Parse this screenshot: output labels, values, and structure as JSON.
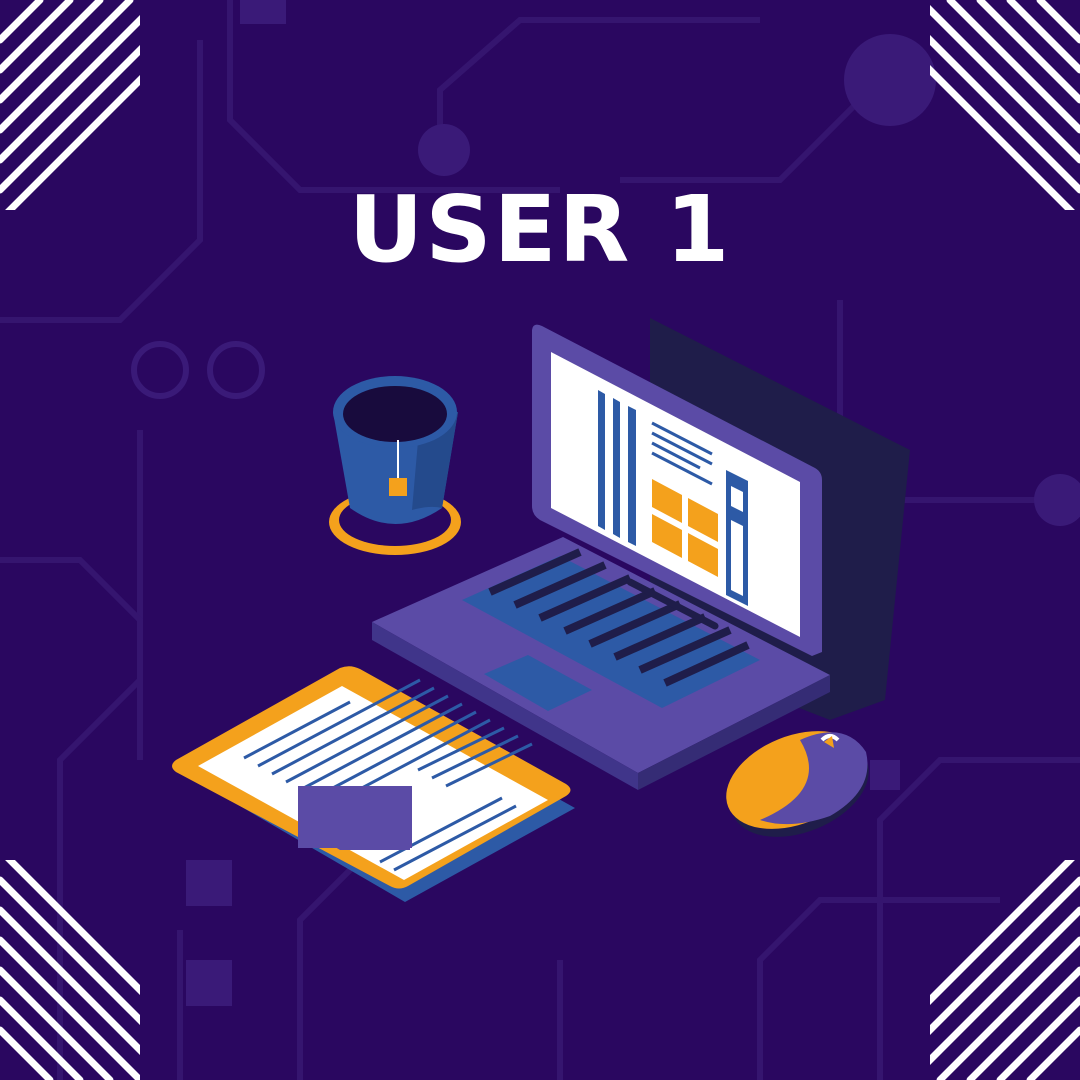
{
  "title": "USER 1",
  "colors": {
    "background": "#2a0760",
    "circuit": "#3a1a78",
    "laptop": "#5b4ba6",
    "laptop_dark": "#1f1d4a",
    "screen": "#ffffff",
    "accent_orange": "#f4a11c",
    "accent_blue": "#2d5aa6",
    "text": "#ffffff"
  },
  "icons": [
    "laptop-icon",
    "cup-icon",
    "tablet-icon",
    "mouse-icon",
    "corner-stripes-icon"
  ]
}
